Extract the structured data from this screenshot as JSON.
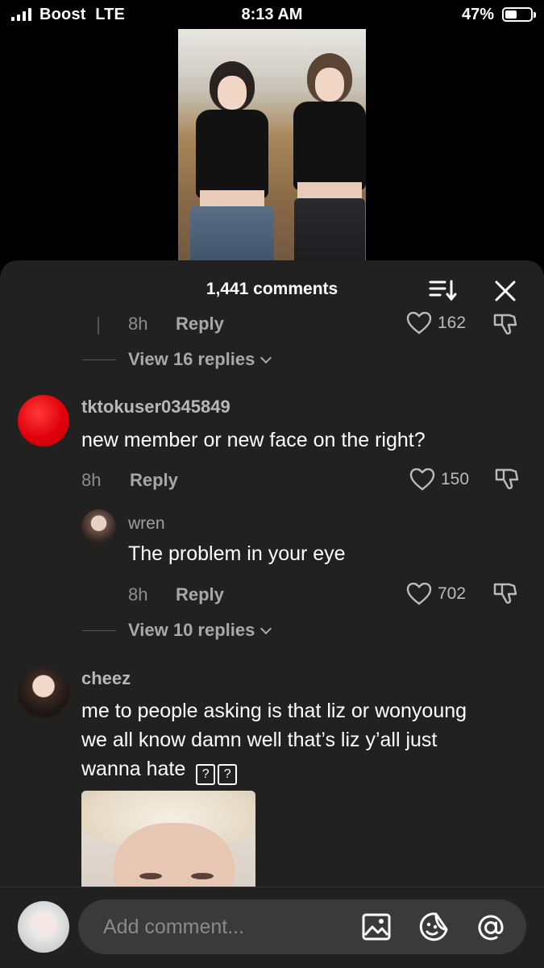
{
  "status_bar": {
    "carrier": "Boost",
    "network": "LTE",
    "time": "8:13 AM",
    "battery": "47%",
    "battery_level": 0.47
  },
  "comments_sheet": {
    "title": "1,441 comments",
    "partial_row": {
      "time": "8h",
      "reply_label": "Reply",
      "likes": "162"
    },
    "view_replies_1": "View 16 replies",
    "comments": [
      {
        "username": "tktokuser0345849",
        "text": "new member or new face on the right?",
        "time": "8h",
        "reply_label": "Reply",
        "likes": "150",
        "replies": [
          {
            "username": "wren",
            "text": "The problem in your eye",
            "time": "8h",
            "reply_label": "Reply",
            "likes": "702"
          }
        ],
        "view_replies": "View 10 replies"
      },
      {
        "username": "cheez",
        "text_line1": "me to people asking is that liz or wonyoung",
        "text_line2": "we all know damn well that’s liz y’all just",
        "text_line3": "wanna hate",
        "emoji_glyph": "?"
      }
    ]
  },
  "composer": {
    "placeholder": "Add comment..."
  },
  "colors": {
    "sheet_bg": "#212121",
    "input_bg": "#3a3a3a",
    "muted_text": "#8e8e8e",
    "avatar_red": "#e0000b"
  },
  "icons": [
    "sort-icon",
    "close-icon",
    "heart-icon",
    "dislike-icon",
    "image-icon",
    "emoji-icon",
    "mention-icon"
  ]
}
